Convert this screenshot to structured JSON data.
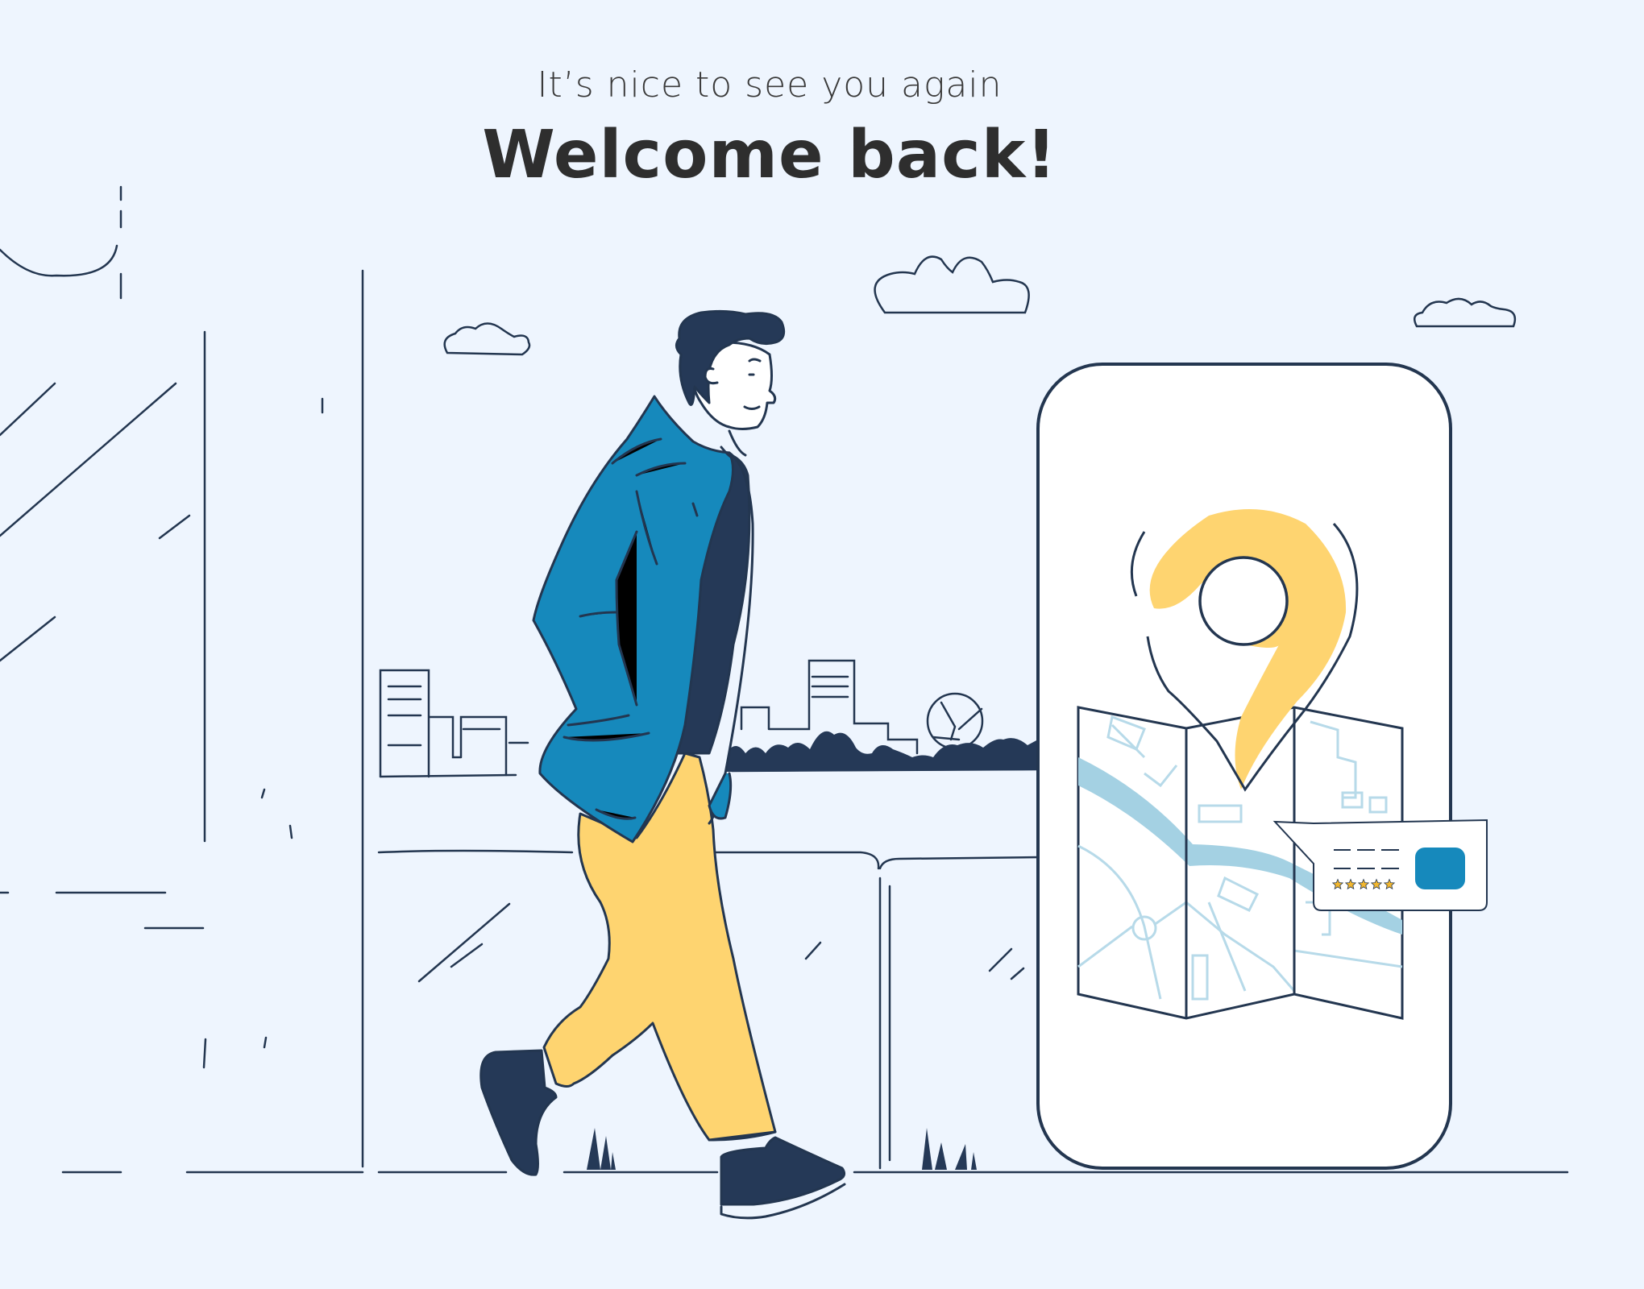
{
  "header": {
    "subtitle": "It’s nice to see you again",
    "title": "Welcome back!"
  },
  "illustration": {
    "review_card": {
      "rating_stars": 5
    }
  },
  "colors": {
    "background": "#EEF5FE",
    "line": "#233650",
    "jacket": "#1689BC",
    "shirt": "#253957",
    "pants": "#FED470",
    "pin": "#FED470",
    "river": "#A4D1E3",
    "map_lines": "#B7DAE9",
    "button": "#1689BC",
    "star": "#F3B72E"
  },
  "icons": {
    "pin": "location-pin-icon",
    "map": "folded-map-icon",
    "star": "star-icon"
  }
}
